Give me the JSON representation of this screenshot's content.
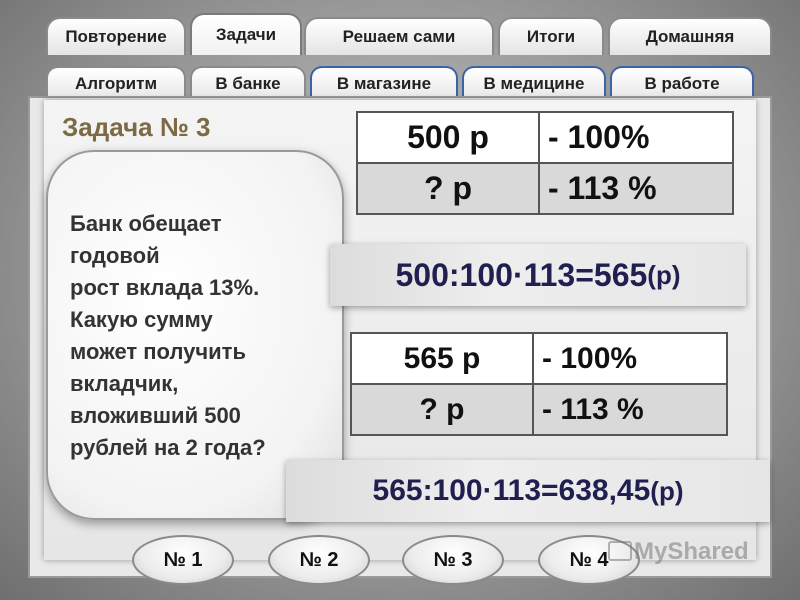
{
  "top_tabs": [
    {
      "label": "Повторение"
    },
    {
      "label": "Задачи",
      "active": true
    },
    {
      "label": "Решаем сами"
    },
    {
      "label": "Итоги"
    },
    {
      "label": "Домашняя"
    }
  ],
  "sub_tabs": [
    {
      "label": "Алгоритм"
    },
    {
      "label": "В банке",
      "active": true
    },
    {
      "label": "В магазине"
    },
    {
      "label": "В медицине"
    },
    {
      "label": "В работе"
    }
  ],
  "task": {
    "title": "Задача № 3",
    "text": "Банк обещает\nгодовой\nрост  вклада 13%.\nКакую сумму\nможет получить\nвкладчик,\nвложивший 500\nрублей на 2 года?"
  },
  "table1": [
    {
      "left": "500 р",
      "right": "- 100%"
    },
    {
      "left": "? р",
      "right": "-  113 %"
    }
  ],
  "formula1": {
    "main": "500:100·113=565",
    "suffix": "(р)"
  },
  "table2": [
    {
      "left": "565 р",
      "right": "- 100%"
    },
    {
      "left": "? р",
      "right": "-  113 %"
    }
  ],
  "formula2": {
    "main": "565:100·113=638,45",
    "suffix": "(р)"
  },
  "nav_buttons": [
    {
      "label": "№ 1"
    },
    {
      "label": "№ 2"
    },
    {
      "label": "№ 3"
    },
    {
      "label": "№ 4"
    }
  ],
  "watermark": "MyShared"
}
